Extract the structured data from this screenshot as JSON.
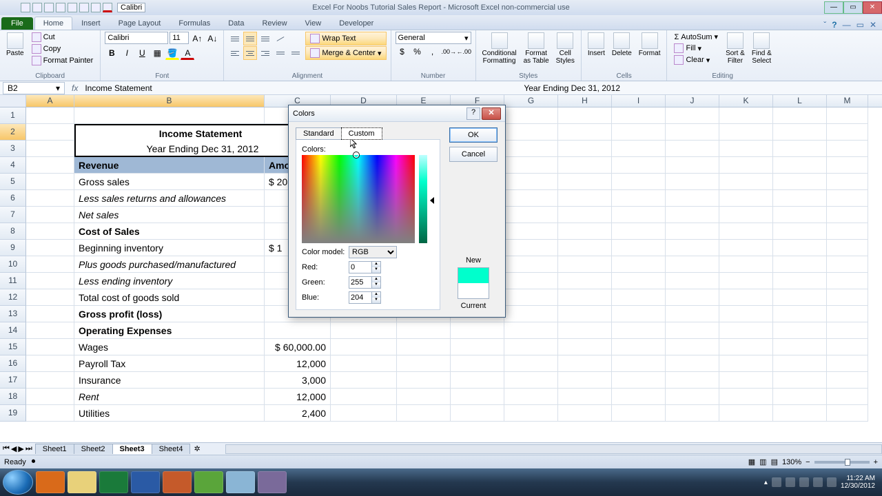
{
  "app_title": "Excel For Noobs Tutorial Sales Report - Microsoft Excel non-commercial use",
  "qat_font": "Calibri",
  "ribbon": {
    "file": "File",
    "tabs": [
      "Home",
      "Insert",
      "Page Layout",
      "Formulas",
      "Data",
      "Review",
      "View",
      "Developer"
    ],
    "active_tab": 0,
    "clipboard": {
      "paste": "Paste",
      "cut": "Cut",
      "copy": "Copy",
      "fmt": "Format Painter",
      "label": "Clipboard"
    },
    "font": {
      "family": "Calibri",
      "size": "11",
      "label": "Font"
    },
    "alignment": {
      "wrap": "Wrap Text",
      "merge": "Merge & Center",
      "label": "Alignment"
    },
    "number": {
      "format": "General",
      "label": "Number"
    },
    "styles": {
      "cond": "Conditional\nFormatting",
      "table": "Format\nas Table",
      "cell": "Cell\nStyles",
      "label": "Styles"
    },
    "cells": {
      "insert": "Insert",
      "delete": "Delete",
      "format": "Format",
      "label": "Cells"
    },
    "editing": {
      "sum": "AutoSum",
      "fill": "Fill",
      "clear": "Clear",
      "sort": "Sort &\nFilter",
      "find": "Find &\nSelect",
      "label": "Editing"
    }
  },
  "name_box": "B2",
  "formula": "Income Statement",
  "formula_right": "Year Ending Dec 31, 2012",
  "cols": [
    "A",
    "B",
    "C",
    "D",
    "E",
    "F",
    "G",
    "H",
    "I",
    "J",
    "K",
    "L",
    "M"
  ],
  "data": {
    "r2": {
      "b": "Income Statement"
    },
    "r3": {
      "b": "Year Ending Dec 31, 2012"
    },
    "r4": {
      "b": "Revenue",
      "c": "Amo"
    },
    "r5": {
      "b": "Gross sales",
      "c": "$ 20"
    },
    "r6": {
      "b": "Less sales returns and allowances"
    },
    "r7": {
      "b": "Net sales"
    },
    "r8": {
      "b": "Cost of Sales"
    },
    "r9": {
      "b": "Beginning inventory",
      "c": "$  1"
    },
    "r10": {
      "b": "Plus goods purchased/manufactured"
    },
    "r11": {
      "b": "Less ending inventory"
    },
    "r12": {
      "b": "Total cost of goods sold"
    },
    "r13": {
      "b": "Gross profit (loss)"
    },
    "r14": {
      "b": "Operating Expenses"
    },
    "r15": {
      "b": "Wages",
      "c": "$  60,000.00"
    },
    "r16": {
      "b": "Payroll Tax",
      "c": "12,000"
    },
    "r17": {
      "b": "Insurance",
      "c": "3,000"
    },
    "r18": {
      "b": "Rent",
      "c": "12,000"
    },
    "r19": {
      "b": "Utilities",
      "c": "2,400"
    }
  },
  "sheets": [
    "Sheet1",
    "Sheet2",
    "Sheet3",
    "Sheet4"
  ],
  "active_sheet": 2,
  "status": {
    "ready": "Ready",
    "zoom": "130%"
  },
  "dialog": {
    "title": "Colors",
    "tabs": [
      "Standard",
      "Custom"
    ],
    "active_tab": 1,
    "colors_label": "Colors:",
    "model_label": "Color model:",
    "model": "RGB",
    "red_label": "Red:",
    "red": "0",
    "green_label": "Green:",
    "green": "255",
    "blue_label": "Blue:",
    "blue": "204",
    "ok": "OK",
    "cancel": "Cancel",
    "new": "New",
    "current": "Current"
  },
  "tray": {
    "time": "11:22 AM",
    "date": "12/30/2012"
  }
}
